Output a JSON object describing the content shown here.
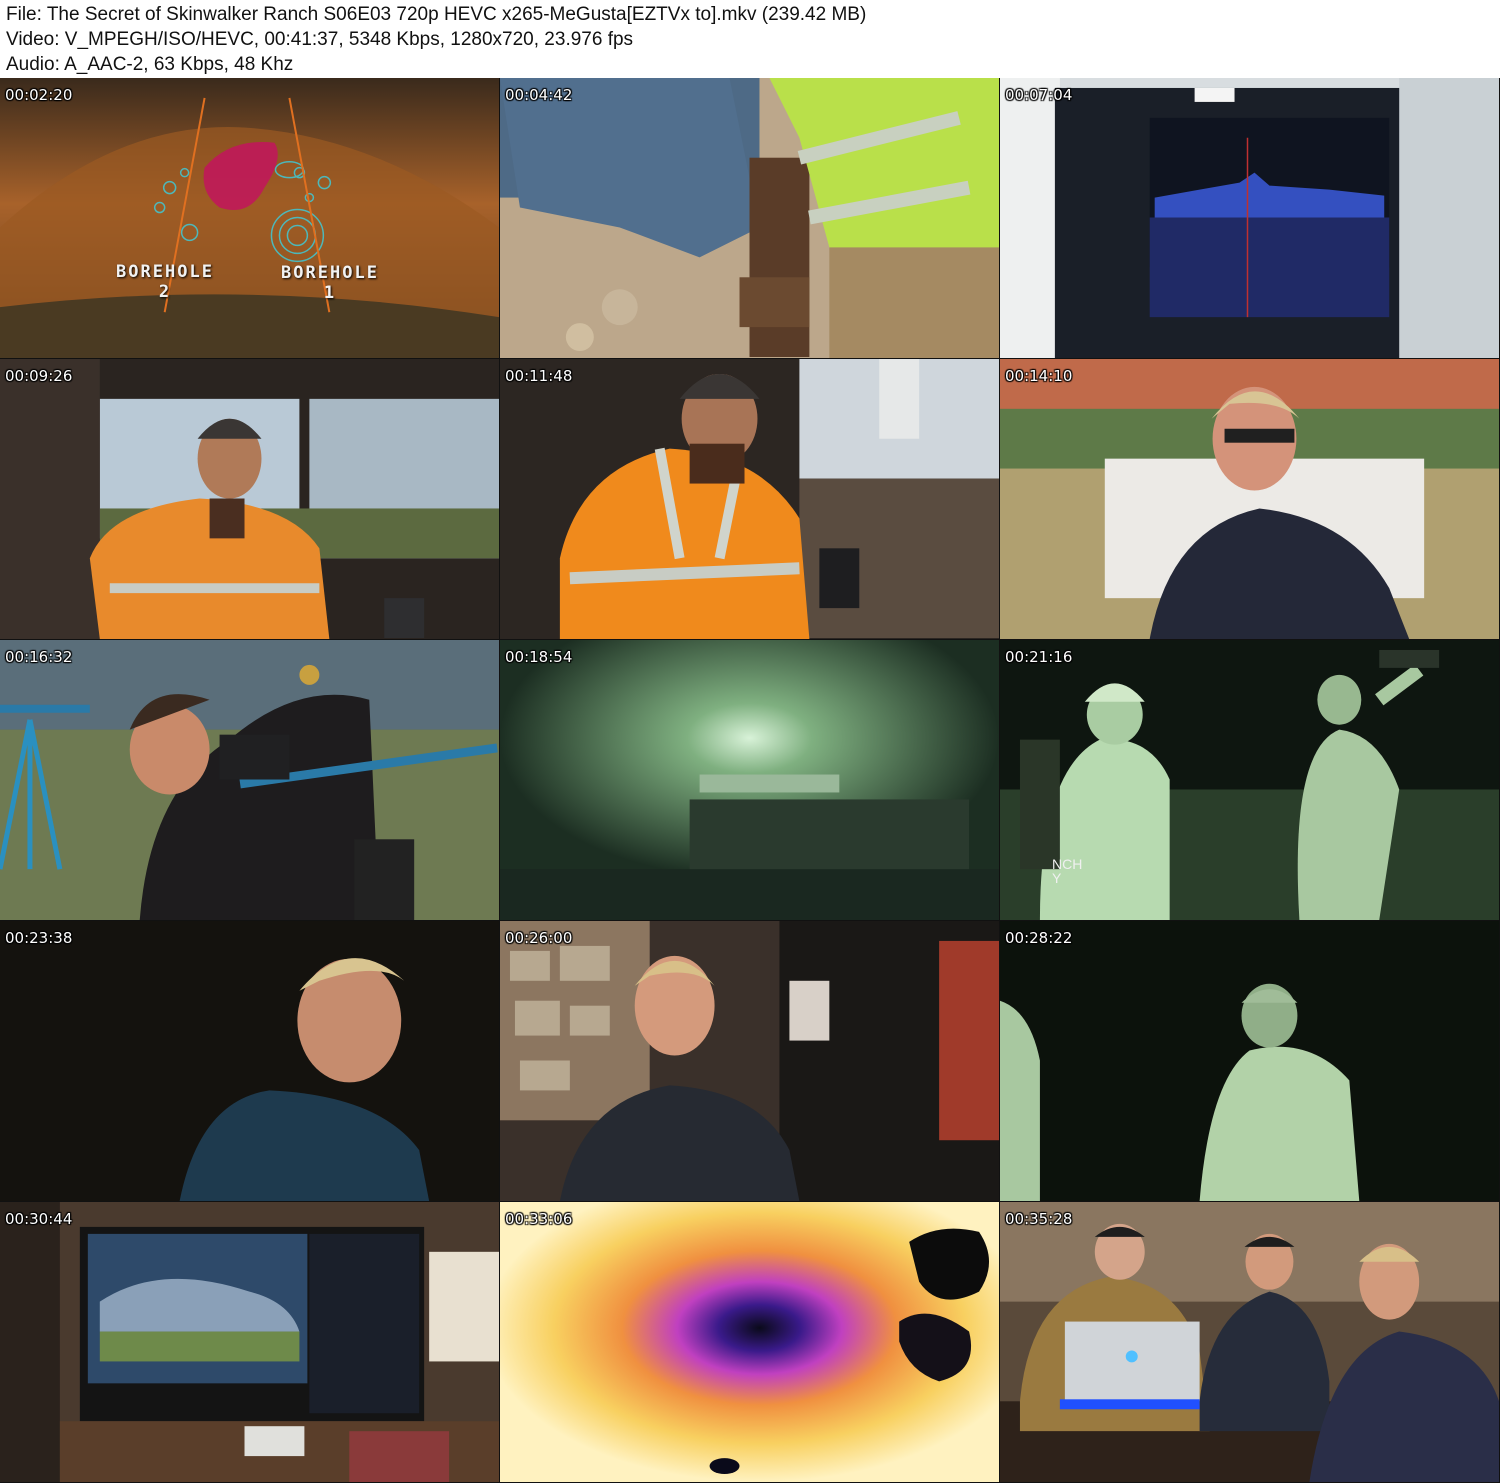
{
  "header": {
    "file_line": "File: The Secret of Skinwalker Ranch S06E03 720p HEVC x265-MeGusta[EZTVx to].mkv (239.42 MB)",
    "video_line": "Video: V_MPEGH/ISO/HEVC, 00:41:37, 5348 Kbps, 1280x720, 23.976 fps",
    "audio_line": "Audio: A_AAC-2, 63 Kbps, 48 Khz"
  },
  "thumbnails": [
    {
      "timestamp": "00:02:20",
      "labels": [
        "BOREHOLE\n2",
        "BOREHOLE\n1"
      ]
    },
    {
      "timestamp": "00:04:42"
    },
    {
      "timestamp": "00:07:04"
    },
    {
      "timestamp": "00:09:26"
    },
    {
      "timestamp": "00:11:48"
    },
    {
      "timestamp": "00:14:10"
    },
    {
      "timestamp": "00:16:32"
    },
    {
      "timestamp": "00:18:54"
    },
    {
      "timestamp": "00:21:16",
      "labels": [
        "NCH\nY"
      ]
    },
    {
      "timestamp": "00:23:38"
    },
    {
      "timestamp": "00:26:00"
    },
    {
      "timestamp": "00:28:22"
    },
    {
      "timestamp": "00:30:44"
    },
    {
      "timestamp": "00:33:06"
    },
    {
      "timestamp": "00:35:28"
    }
  ]
}
